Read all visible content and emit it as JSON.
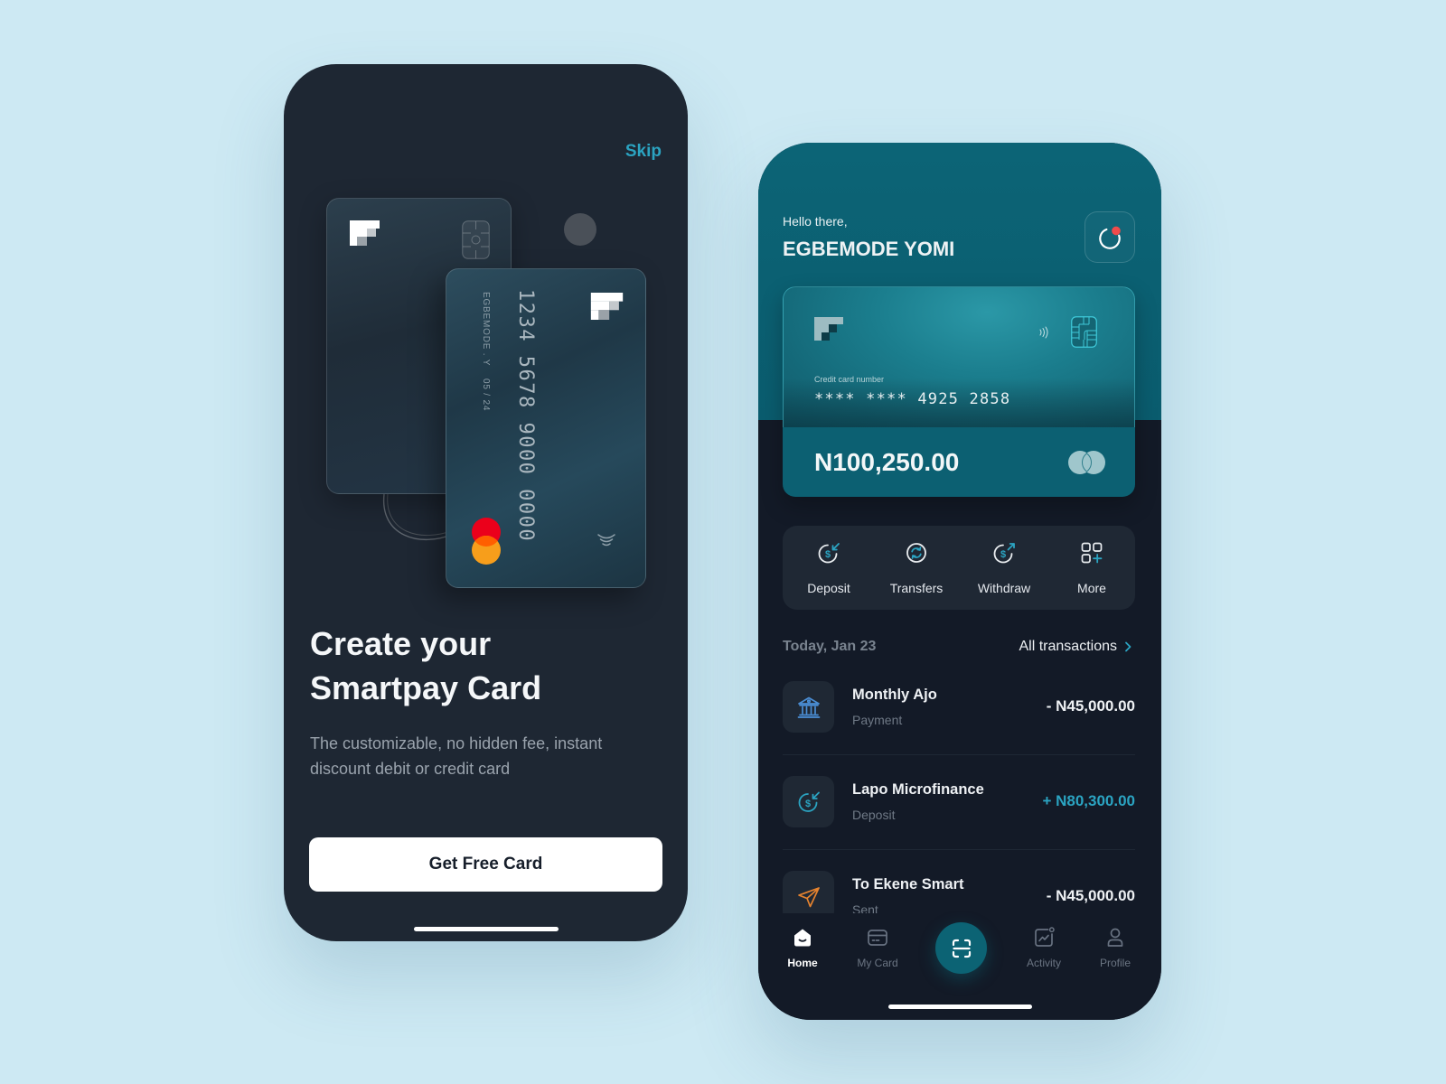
{
  "onboarding": {
    "skip_label": "Skip",
    "front_card": {
      "number": "1234 5678 9000 0000",
      "holder_name": "EGBEMODE . Y",
      "expiry": "05 / 24",
      "network": "mastercard"
    },
    "title": "Create your Smartpay Card",
    "subtitle": "The customizable, no hidden fee, instant discount debit or credit card",
    "cta_label": "Get Free Card"
  },
  "home": {
    "greeting": "Hello there,",
    "user_name": "EGBEMODE YOMI",
    "notification_icon": "notification-icon",
    "has_unread_notification": true,
    "card": {
      "number_label": "Credit card number",
      "number_masked": "**** **** 4925 2858",
      "balance": "N100,250.00",
      "network": "mastercard"
    },
    "quick_actions": [
      {
        "label": "Deposit",
        "icon": "deposit-icon"
      },
      {
        "label": "Transfers",
        "icon": "transfer-icon"
      },
      {
        "label": "Withdraw",
        "icon": "withdraw-icon"
      },
      {
        "label": "More",
        "icon": "more-grid-icon"
      }
    ],
    "transactions_header": {
      "date": "Today, Jan 23",
      "all_label": "All transactions"
    },
    "transactions": [
      {
        "title": "Monthly Ajo",
        "type": "Payment",
        "amount": "- N45,000.00",
        "direction": "debit",
        "icon": "bank-icon"
      },
      {
        "title": "Lapo Microfinance",
        "type": "Deposit",
        "amount": "+ N80,300.00",
        "direction": "credit",
        "icon": "deposit-icon"
      },
      {
        "title": "To Ekene Smart",
        "type": "Sent",
        "amount": "- N45,000.00",
        "direction": "debit",
        "icon": "send-icon"
      }
    ],
    "bottom_nav": [
      {
        "label": "Home",
        "icon": "home-icon",
        "active": true
      },
      {
        "label": "My Card",
        "icon": "card-icon",
        "active": false
      },
      {
        "label": "",
        "icon": "scan-icon",
        "active": false
      },
      {
        "label": "Activity",
        "icon": "activity-icon",
        "active": false
      },
      {
        "label": "Profile",
        "icon": "profile-icon",
        "active": false
      }
    ]
  },
  "colors": {
    "page_background": "#cde9f3",
    "accent": "#2ba4c2",
    "brand_teal": "#0b6173",
    "onboarding_background": "#1e2733",
    "home_background": "#131a27",
    "debit_amount": "#eef1f4",
    "credit_amount": "#2ba4c2",
    "notification_dot": "#f04b4b",
    "cta_background": "#ffffff"
  }
}
